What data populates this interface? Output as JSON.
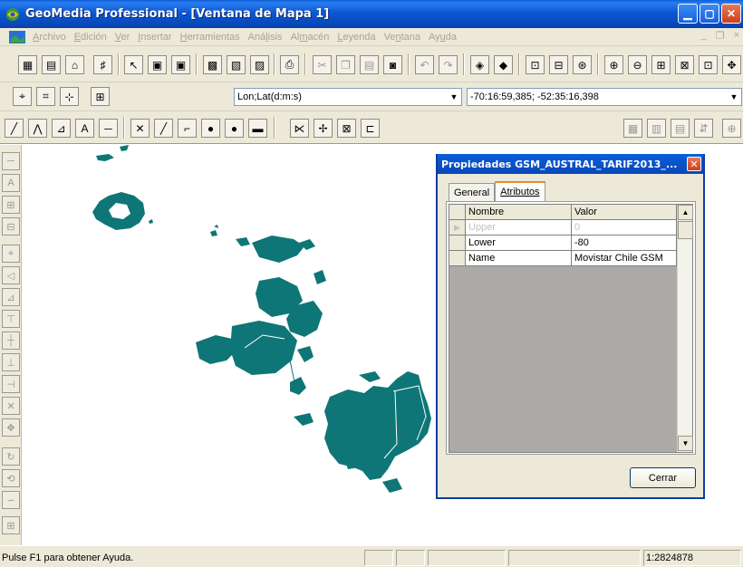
{
  "window": {
    "title": "GeoMedia Professional - [Ventana de Mapa 1]"
  },
  "menu": {
    "items": [
      {
        "label": "Archivo",
        "key": "A"
      },
      {
        "label": "Edición",
        "key": "E"
      },
      {
        "label": "Ver",
        "key": "V"
      },
      {
        "label": "Insertar",
        "key": "I"
      },
      {
        "label": "Herramientas",
        "key": "H"
      },
      {
        "label": "Análisis",
        "key": "l"
      },
      {
        "label": "Almacén",
        "key": "m"
      },
      {
        "label": "Leyenda",
        "key": "L"
      },
      {
        "label": "Ventana",
        "key": "n"
      },
      {
        "label": "Ayuda",
        "key": "u"
      }
    ],
    "mdi_controls": [
      "_",
      "❐",
      "×"
    ]
  },
  "coordinates": {
    "format_value": "Lon;Lat(d:m:s)",
    "position_value": "-70:16:59,385; -52:35:16,398"
  },
  "dialog": {
    "title": "Propiedades GSM_AUSTRAL_TARIF2013_...",
    "tabs": [
      {
        "label": "General",
        "active": false
      },
      {
        "label": "Atributos",
        "active": true
      }
    ],
    "grid": {
      "headers": [
        "Nombre",
        "Valor"
      ],
      "rows": [
        {
          "name": "Upper",
          "value": "0",
          "current": true
        },
        {
          "name": "Lower",
          "value": "-80",
          "current": false
        },
        {
          "name": "Name",
          "value": "Movistar Chile GSM",
          "current": false
        }
      ]
    },
    "close_label": "Cerrar"
  },
  "status": {
    "help_text": "Pulse F1 para obtener Ayuda.",
    "scale": "1:2824878"
  },
  "colors": {
    "map_feature": "#0e7676",
    "titlebar": "#0a58d2"
  }
}
